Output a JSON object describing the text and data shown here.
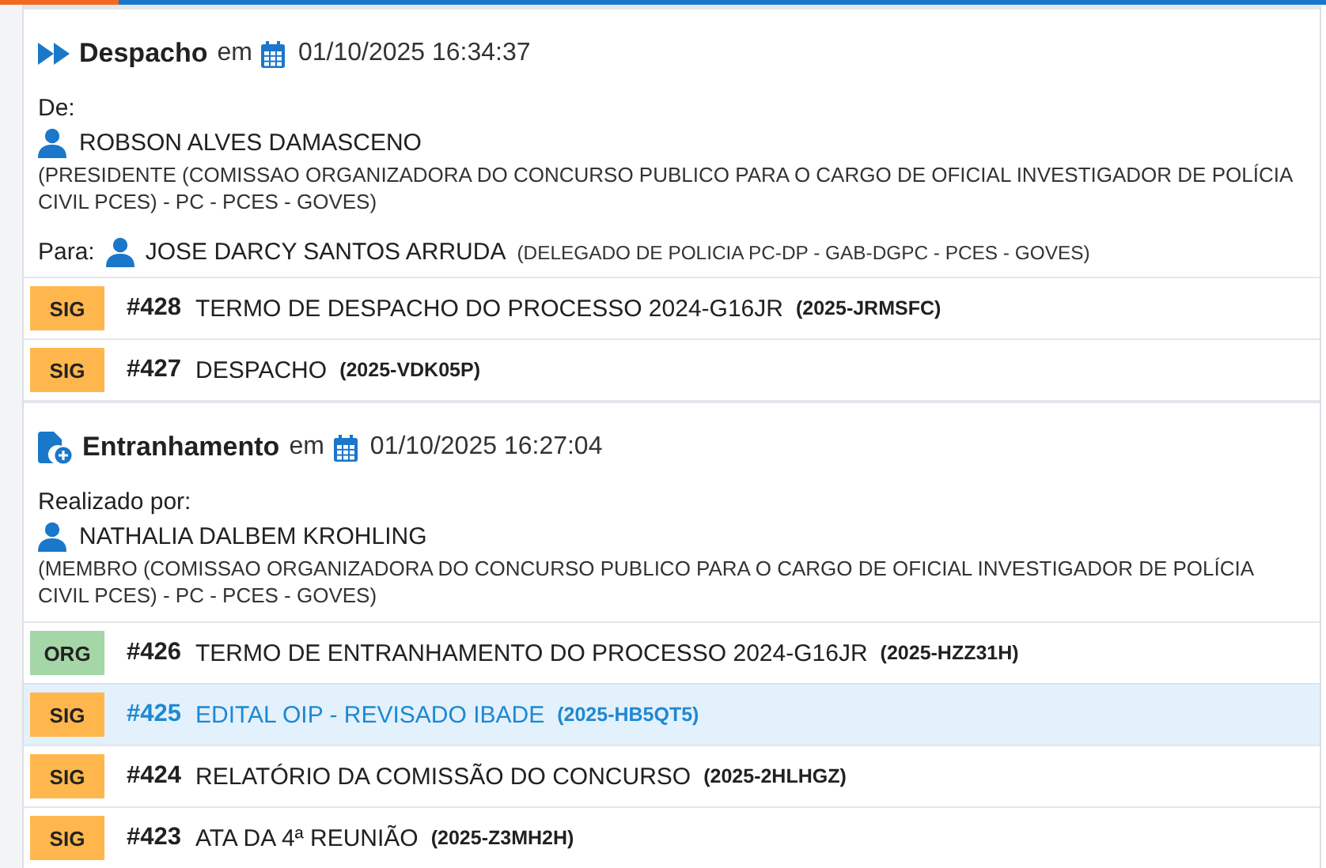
{
  "events": [
    {
      "kind": "despacho",
      "title": "Despacho",
      "connector": "em",
      "datetime": "01/10/2025 16:34:37",
      "from": {
        "label": "De:",
        "name": "ROBSON ALVES DAMASCENO",
        "role": "(PRESIDENTE (COMISSAO ORGANIZADORA DO CONCURSO PUBLICO PARA O CARGO DE OFICIAL INVESTIGADOR DE POLÍCIA CIVIL PCES) - PC - PCES - GOVES)"
      },
      "to": {
        "label": "Para:",
        "name": "JOSE DARCY SANTOS ARRUDA",
        "role": "(DELEGADO DE POLICIA PC-DP - GAB-DGPC - PCES - GOVES)"
      },
      "documents": [
        {
          "tag": "SIG",
          "color": "#ffb74d",
          "number": "#428",
          "title": "TERMO DE DESPACHO DO PROCESSO 2024-G16JR",
          "code": "(2025-JRMSFC)",
          "selected": false
        },
        {
          "tag": "SIG",
          "color": "#ffb74d",
          "number": "#427",
          "title": "DESPACHO",
          "code": "(2025-VDK05P)",
          "selected": false
        }
      ]
    },
    {
      "kind": "entranhamento",
      "title": "Entranhamento",
      "connector": "em",
      "datetime": "01/10/2025 16:27:04",
      "from": {
        "label": "Realizado por:",
        "name": "NATHALIA DALBEM KROHLING",
        "role": "(MEMBRO (COMISSAO ORGANIZADORA DO CONCURSO PUBLICO PARA O CARGO DE OFICIAL INVESTIGADOR DE POLÍCIA CIVIL PCES) - PC - PCES - GOVES)"
      },
      "documents": [
        {
          "tag": "ORG",
          "color": "#a5d6a7",
          "number": "#426",
          "title": "TERMO DE ENTRANHAMENTO DO PROCESSO 2024-G16JR",
          "code": "(2025-HZZ31H)",
          "selected": false
        },
        {
          "tag": "SIG",
          "color": "#ffb74d",
          "number": "#425",
          "title": "EDITAL OIP - REVISADO IBADE",
          "code": "(2025-HB5QT5)",
          "selected": true
        },
        {
          "tag": "SIG",
          "color": "#ffb74d",
          "number": "#424",
          "title": "RELATÓRIO DA COMISSÃO DO CONCURSO",
          "code": "(2025-2HLHGZ)",
          "selected": false
        },
        {
          "tag": "SIG",
          "color": "#ffb74d",
          "number": "#423",
          "title": "ATA DA 4ª REUNIÃO",
          "code": "(2025-Z3MH2H)",
          "selected": false
        }
      ]
    }
  ]
}
